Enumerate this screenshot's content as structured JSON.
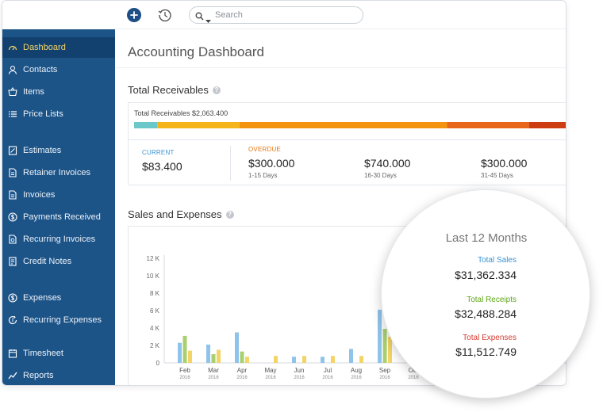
{
  "toolbar": {
    "add_icon": "plus-circle-icon",
    "history_icon": "history-icon",
    "search_placeholder": "Search"
  },
  "colors": {
    "sidebar": "#1d5488",
    "sidebar_active": "#13416f",
    "current": "#3a93d3",
    "overdue": "#e8760f",
    "sales": "#3a93d3",
    "receipts": "#5fa617",
    "expenses": "#d63c31"
  },
  "sidebar": {
    "items": [
      {
        "label": "Dashboard",
        "icon": "dashboard-icon",
        "active": true
      },
      {
        "label": "Contacts",
        "icon": "contact-icon"
      },
      {
        "label": "Items",
        "icon": "basket-icon"
      },
      {
        "label": "Price Lists",
        "icon": "list-icon"
      },
      {
        "label": "Estimates",
        "icon": "estimate-icon"
      },
      {
        "label": "Retainer Invoices",
        "icon": "document-icon"
      },
      {
        "label": "Invoices",
        "icon": "document-icon"
      },
      {
        "label": "Payments Received",
        "icon": "payment-icon"
      },
      {
        "label": "Recurring Invoices",
        "icon": "recurring-document-icon"
      },
      {
        "label": "Credit Notes",
        "icon": "credit-note-icon"
      },
      {
        "label": "Expenses",
        "icon": "expense-icon"
      },
      {
        "label": "Recurring Expenses",
        "icon": "recurring-expense-icon"
      },
      {
        "label": "Timesheet",
        "icon": "calendar-icon"
      },
      {
        "label": "Reports",
        "icon": "chart-line-icon"
      }
    ]
  },
  "main": {
    "title": "Accounting Dashboard",
    "receivables": {
      "title": "Total Receivables",
      "caption": "Total Receivables $2,063.400",
      "current_label": "CURRENT",
      "current_amount": "$83.400",
      "overdue_label": "OVERDUE",
      "buckets": [
        {
          "amount": "$300.000",
          "range": "1-15 Days"
        },
        {
          "amount": "$740.000",
          "range": "16-30 Days"
        },
        {
          "amount": "$300.000",
          "range": "31-45 Days"
        }
      ],
      "bar_segments": [
        {
          "share": 0.053,
          "color": "#6cc8c8"
        },
        {
          "share": 0.187,
          "color": "#f6b41b"
        },
        {
          "share": 0.473,
          "color": "#f3930f"
        },
        {
          "share": 0.187,
          "color": "#e8661a"
        },
        {
          "share": 0.1,
          "color": "#cc3e12"
        }
      ]
    },
    "sales_expenses": {
      "title": "Sales and Expenses"
    }
  },
  "chart_data": {
    "type": "bar",
    "title": "",
    "xlabel": "",
    "ylabel": "",
    "ylim": [
      0,
      12000
    ],
    "yticks": [
      "0",
      "2 K",
      "4 K",
      "6 K",
      "8 K",
      "10 K",
      "12 K"
    ],
    "categories": [
      "Feb",
      "Mar",
      "Apr",
      "May",
      "Jun",
      "Jul",
      "Aug",
      "Sep",
      "Oct"
    ],
    "category_sublabel": "2016",
    "grid": false,
    "series": [
      {
        "color": "#8ec3ea",
        "values": [
          2300,
          2100,
          3500,
          0,
          700,
          700,
          1600,
          6100,
          0
        ]
      },
      {
        "color": "#a8d06f",
        "values": [
          3100,
          1000,
          1300,
          0,
          0,
          0,
          0,
          3900,
          0
        ]
      },
      {
        "color": "#f3d467",
        "values": [
          1400,
          1500,
          700,
          800,
          800,
          800,
          800,
          3000,
          0
        ]
      }
    ]
  },
  "summary": {
    "title": "Last 12 Months",
    "total_sales_label": "Total Sales",
    "total_sales_value": "$31,362.334",
    "total_receipts_label": "Total Receipts",
    "total_receipts_value": "$32,488.284",
    "total_expenses_label": "Total Expenses",
    "total_expenses_value": "$11,512.749"
  }
}
